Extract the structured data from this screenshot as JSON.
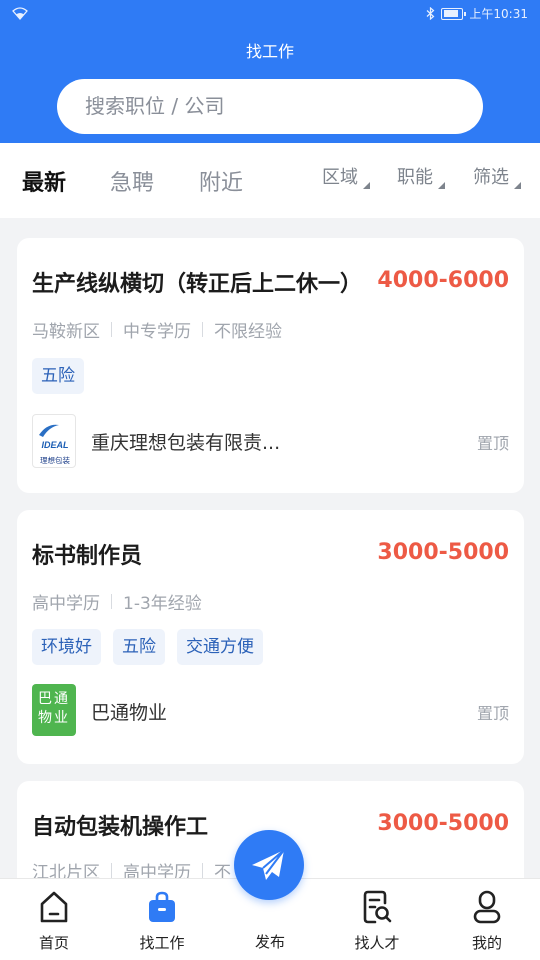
{
  "status_bar": {
    "time": "上午10:31"
  },
  "header": {
    "title": "找工作",
    "search_placeholder": "搜索职位 / 公司"
  },
  "filter_tabs": [
    {
      "label": "最新"
    },
    {
      "label": "急聘"
    },
    {
      "label": "附近"
    }
  ],
  "filters": [
    {
      "label": "区域"
    },
    {
      "label": "职能"
    },
    {
      "label": "筛选"
    }
  ],
  "jobs": [
    {
      "title": "生产线纵横切（转正后上二休一）",
      "salary": "4000-6000",
      "meta": [
        "马鞍新区",
        "中专学历",
        "不限经验"
      ],
      "tags": [
        "五险"
      ],
      "company": "重庆理想包装有限责...",
      "logo": {
        "line1": "IDEAL",
        "line2": "理想包装"
      },
      "pin": "置顶"
    },
    {
      "title": "标书制作员",
      "salary": "3000-5000",
      "meta": [
        "高中学历",
        "1-3年经验"
      ],
      "tags": [
        "环境好",
        "五险",
        "交通方便"
      ],
      "company": "巴通物业",
      "logo": {
        "line1": "巴通",
        "line2": "物业"
      },
      "pin": "置顶"
    },
    {
      "title": "自动包装机操作工",
      "salary": "3000-5000",
      "meta": [
        "江北片区",
        "高中学历",
        "不"
      ]
    }
  ],
  "tabbar": {
    "home": "首页",
    "find_job": "找工作",
    "publish": "发布",
    "find_talent": "找人才",
    "mine": "我的"
  },
  "colors": {
    "primary": "#2f7bf5",
    "salary": "#ed5a45",
    "tag_text": "#2c62b8",
    "tag_bg": "#eef3fb"
  }
}
